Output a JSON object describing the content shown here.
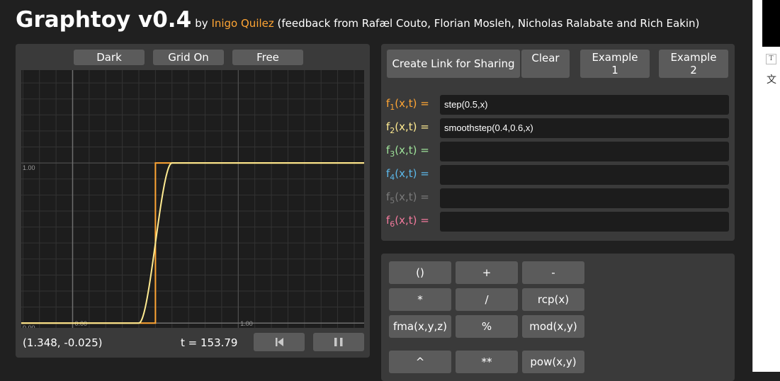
{
  "header": {
    "title": "Graphtoy v0.4",
    "by": "by",
    "author": "Inigo Quilez",
    "feedback": "(feedback from Rafæl Couto, Florian Mosleh, Nicholas Ralabate and Rich Eakin)"
  },
  "graph": {
    "toggles": [
      "Dark",
      "Grid On",
      "Free"
    ],
    "coords": "(1.348, -0.025)",
    "time": "t = 153.79",
    "controls": [
      "skip-back-icon",
      "pause-icon"
    ]
  },
  "chart_data": {
    "type": "line",
    "grid": true,
    "x_ticks": [
      "0.00",
      "1.00"
    ],
    "y_ticks": [
      "0.00",
      "1.00"
    ],
    "xlim": [
      -0.31,
      1.76
    ],
    "ylim": [
      -0.03,
      1.58
    ],
    "series": [
      {
        "name": "step(0.5,x)",
        "color": "#ffa534",
        "x": [
          -0.31,
          0.5,
          0.5,
          1.76
        ],
        "y": [
          0,
          0,
          1,
          1
        ]
      },
      {
        "name": "smoothstep(0.4,0.6,x)",
        "color": "#ffeb91",
        "x": [
          -0.31,
          0.4,
          0.5,
          0.6,
          1.76
        ],
        "y": [
          0,
          0,
          0.5,
          1,
          1
        ]
      }
    ]
  },
  "functions": {
    "top_buttons": [
      "Create Link for Sharing",
      "Clear",
      "Example 1",
      "Example 2"
    ],
    "rows": [
      {
        "label": "f",
        "index": "1",
        "args": "(x,t) =",
        "color": "#ffa534",
        "expr": "step(0.5,x)"
      },
      {
        "label": "f",
        "index": "2",
        "args": "(x,t) =",
        "color": "#ffeb91",
        "expr": "smoothstep(0.4,0.6,x)"
      },
      {
        "label": "f",
        "index": "3",
        "args": "(x,t) =",
        "color": "#9fe39a",
        "expr": ""
      },
      {
        "label": "f",
        "index": "4",
        "args": "(x,t) =",
        "color": "#5cb8ea",
        "expr": ""
      },
      {
        "label": "f",
        "index": "5",
        "args": "(x,t) =",
        "color": "#7a7a7a",
        "expr": ""
      },
      {
        "label": "f",
        "index": "6",
        "args": "(x,t) =",
        "color": "#f37a9d",
        "expr": ""
      }
    ]
  },
  "keyboard": {
    "keys": [
      "()",
      "+",
      "-",
      "*",
      "/",
      "rcp(x)",
      "fma(x,y,z)",
      "%",
      "mod(x,y)",
      "^",
      "**",
      "pow(x,y)"
    ]
  },
  "extension": {
    "t_icon": "T",
    "translate_glyph": "文"
  }
}
